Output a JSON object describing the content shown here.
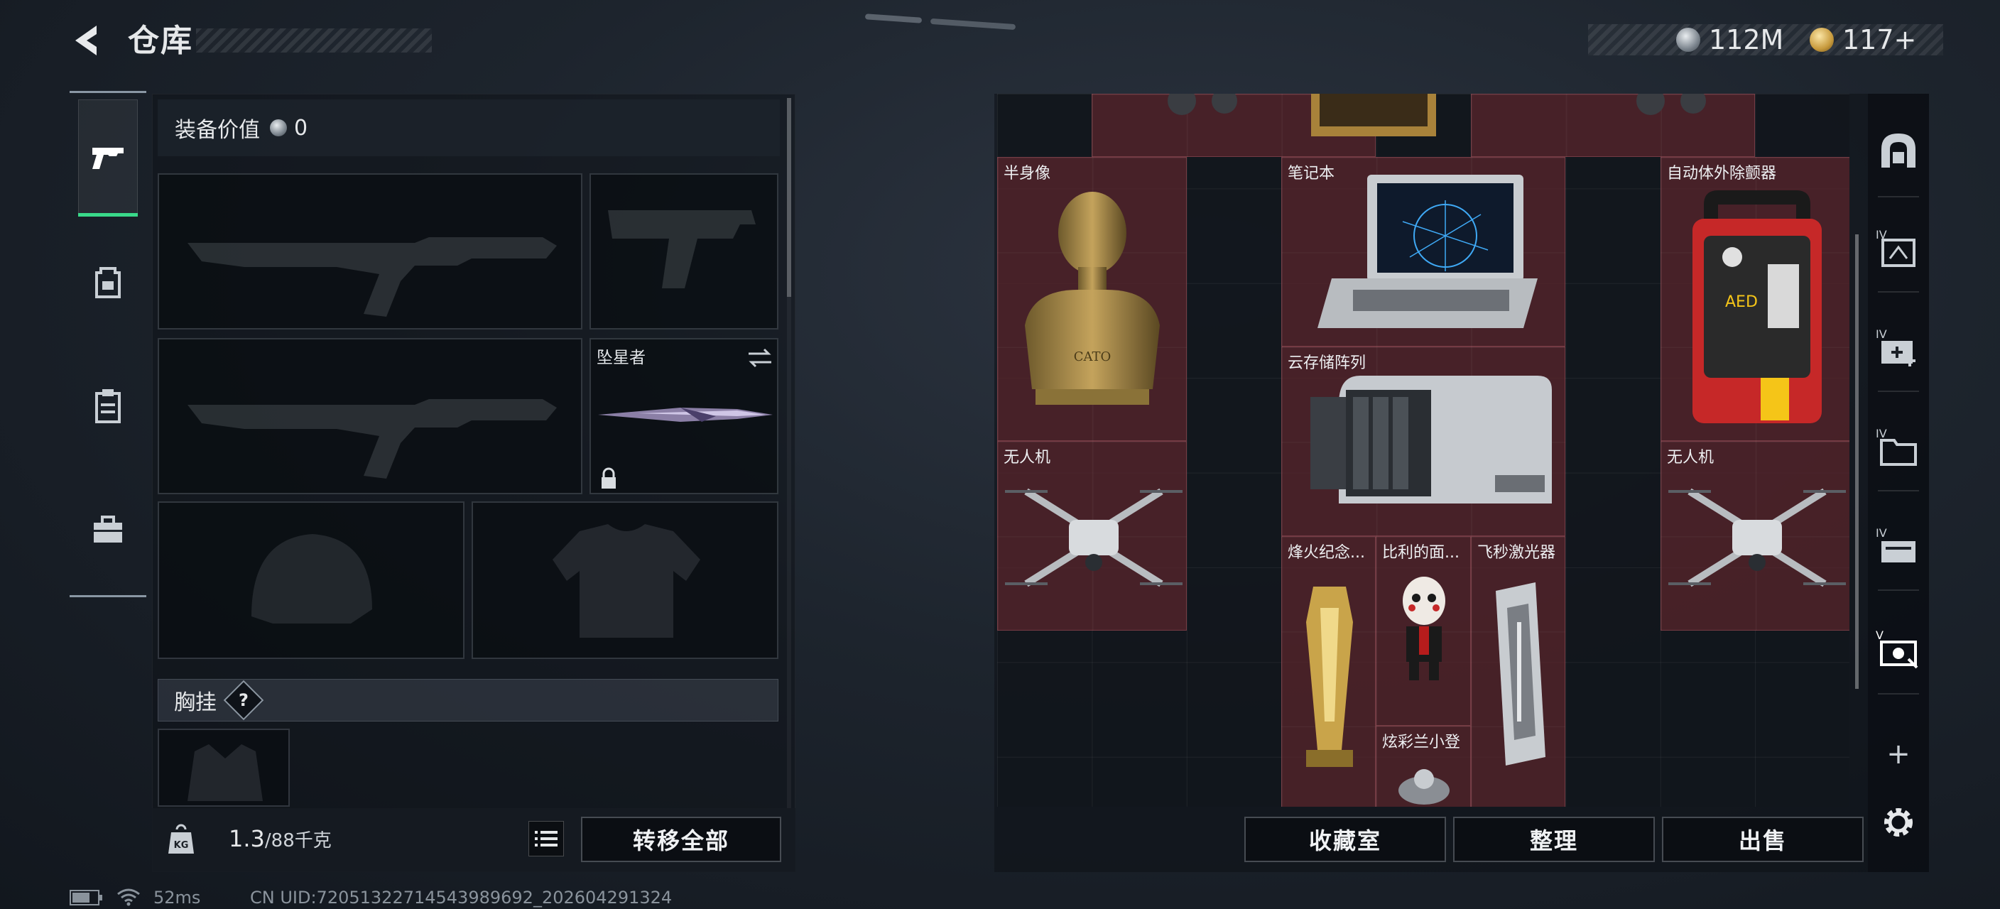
{
  "header": {
    "title": "仓库",
    "currencies": [
      {
        "icon": "silver-coin-icon",
        "value": "112M"
      },
      {
        "icon": "gold-coin-icon",
        "value": "117+"
      }
    ]
  },
  "left_nav": [
    {
      "icon": "pistol-icon",
      "active": true
    },
    {
      "icon": "backpack-icon",
      "active": false
    },
    {
      "icon": "clipboard-icon",
      "active": false
    },
    {
      "icon": "toolbox-icon",
      "active": false
    }
  ],
  "equipment": {
    "value_label": "装备价值",
    "value": "0",
    "melee_label": "坠星者",
    "chest_label": "胸挂",
    "chest_help": "?",
    "weight_current": "1.3",
    "weight_max": "/88千克",
    "weight_unit_icon": "KG",
    "transfer_all": "转移全部"
  },
  "storage": {
    "items": [
      {
        "label": "半身像"
      },
      {
        "label": "笔记本"
      },
      {
        "label": "自动体外除颤器"
      },
      {
        "label": "云存储阵列"
      },
      {
        "label": "无人机"
      },
      {
        "label": "无人机"
      },
      {
        "label": "烽火纪念..."
      },
      {
        "label": "比利的面..."
      },
      {
        "label": "飞秒激光器"
      },
      {
        "label": "炫彩兰小登"
      }
    ],
    "buttons": {
      "collection": "收藏室",
      "sort": "整理",
      "sell": "出售"
    },
    "bust_engraving": "CATO",
    "aed_text": "AED",
    "right_tabs": [
      "safe-icon",
      "IV",
      "IV",
      "IV",
      "IV",
      "V",
      "+"
    ]
  },
  "status_bar": {
    "ping": "52ms",
    "uid": "CN UID:720513227145439896​92_202604291324"
  },
  "colors": {
    "accent_green": "#39d98a",
    "item_cell_red": "#5c262c",
    "panel_bg": "#12171e"
  }
}
